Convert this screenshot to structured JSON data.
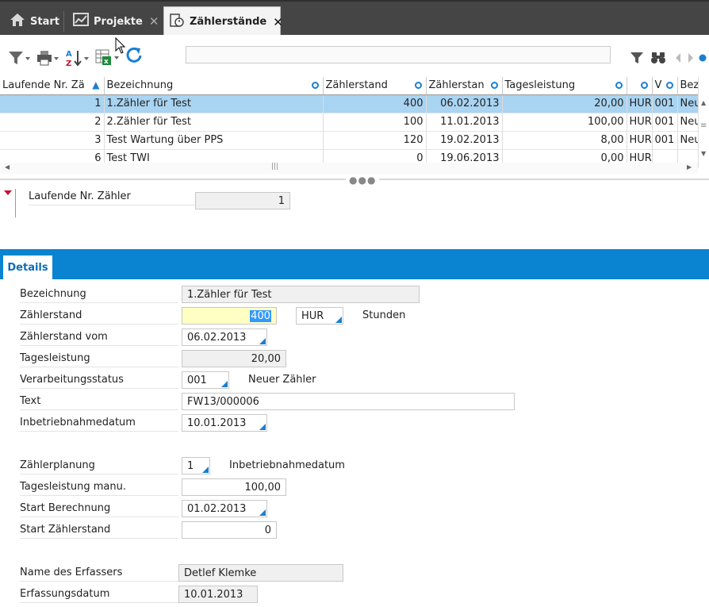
{
  "tabs": [
    {
      "label": "Start",
      "icon": "home-icon"
    },
    {
      "label": "Projekte",
      "icon": "chart-icon"
    },
    {
      "label": "Zählerstände",
      "icon": "meter-icon"
    }
  ],
  "toolbar": {
    "search_value": "",
    "icons": [
      "filter-dropdown-icon",
      "print-icon",
      "sort-az-icon",
      "excel-export-icon",
      "refresh-icon",
      "filter-icon",
      "binoculars-icon",
      "nav-left-icon",
      "nav-right-icon"
    ]
  },
  "grid": {
    "columns": [
      "Laufende Nr. Zä",
      "Bezeichnung",
      "Zählerstand",
      "Zählerstan",
      "Tagesleistung",
      "",
      "V",
      "Bez"
    ],
    "rows": [
      {
        "nr": "1",
        "bez": "1.Zähler für Test",
        "stand": "400",
        "datum": "06.02.2013",
        "tl": "20,00",
        "einheit": "HUR",
        "v": "001",
        "bez2": "Neu"
      },
      {
        "nr": "2",
        "bez": "2.Zähler für Test",
        "stand": "100",
        "datum": "11.01.2013",
        "tl": "100,00",
        "einheit": "HUR",
        "v": "001",
        "bez2": "Neu"
      },
      {
        "nr": "3",
        "bez": "Test Wartung über PPS",
        "stand": "120",
        "datum": "19.02.2013",
        "tl": "8,00",
        "einheit": "HUR",
        "v": "001",
        "bez2": "Neu"
      },
      {
        "nr": "6",
        "bez": "Test TWI",
        "stand": "0",
        "datum": "19.06.2013",
        "tl": "0,00",
        "einheit": "HUR",
        "v": "",
        "bez2": ""
      }
    ]
  },
  "key": {
    "label": "Laufende Nr. Zähler",
    "value": "1"
  },
  "details": {
    "tab_label": "Details",
    "bezeichnung": {
      "label": "Bezeichnung",
      "value": "1.Zähler für Test"
    },
    "zaehlerstand": {
      "label": "Zählerstand",
      "value": "400",
      "unit": "HUR",
      "unit_text": "Stunden"
    },
    "zaehlerstand_vom": {
      "label": "Zählerstand vom",
      "value": "06.02.2013"
    },
    "tagesleistung": {
      "label": "Tagesleistung",
      "value": "20,00"
    },
    "verarbeitungsstatus": {
      "label": "Verarbeitungsstatus",
      "value": "001",
      "text": "Neuer Zähler"
    },
    "text": {
      "label": "Text",
      "value": "FW13/000006"
    },
    "inbetriebnahmedatum": {
      "label": "Inbetriebnahmedatum",
      "value": "10.01.2013"
    },
    "zaehlerplanung": {
      "label": "Zählerplanung",
      "value": "1",
      "text": "Inbetriebnahmedatum"
    },
    "tagesleistung_manu": {
      "label": "Tagesleistung manu.",
      "value": "100,00"
    },
    "start_berechnung": {
      "label": "Start Berechnung",
      "value": "01.02.2013"
    },
    "start_zaehlerstand": {
      "label": "Start Zählerstand",
      "value": "0"
    },
    "erfasser": {
      "label": "Name des Erfassers",
      "value": "Detlef Klemke"
    },
    "erfassungsdatum": {
      "label": "Erfassungsdatum",
      "value": "10.01.2013"
    }
  },
  "colors": {
    "accent": "#0a84d0",
    "selection": "#a9d4f2",
    "tabbar": "#454545"
  }
}
